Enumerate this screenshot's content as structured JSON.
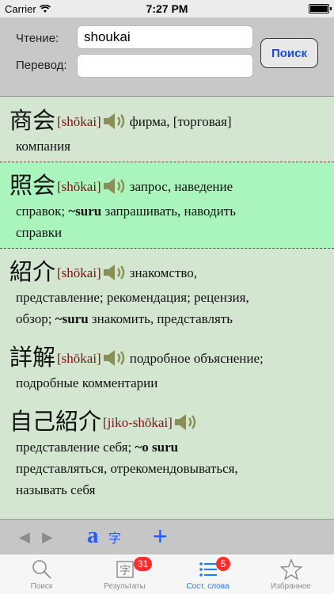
{
  "status_bar": {
    "carrier": "Carrier",
    "time": "7:27 PM"
  },
  "form": {
    "reading_label": "Чтение:",
    "reading_value": "shoukai",
    "translation_label": "Перевод:",
    "translation_value": "",
    "search_button": "Поиск"
  },
  "entries": [
    {
      "kanji": "商会",
      "reading": "[shōkai]",
      "def": "фирма, [торговая]",
      "line2": [
        {
          "text": "компания",
          "bold": false
        }
      ]
    },
    {
      "kanji": "照会",
      "reading": "[shōkai]",
      "def": "запрос, наведение",
      "line2": [
        {
          "text": "справок; ",
          "bold": false
        },
        {
          "text": "~suru",
          "bold": true
        },
        {
          "text": " запрашивать, наводить",
          "bold": false
        }
      ],
      "line3": [
        {
          "text": "справки",
          "bold": false
        }
      ]
    },
    {
      "kanji": "紹介",
      "reading": "[shōkai]",
      "def": "знакомство,",
      "line2": [
        {
          "text": "представление; рекомендация; рецензия,",
          "bold": false
        }
      ],
      "line3": [
        {
          "text": "обзор; ",
          "bold": false
        },
        {
          "text": "~suru",
          "bold": true
        },
        {
          "text": " знакомить, представлять",
          "bold": false
        }
      ]
    },
    {
      "kanji": "詳解",
      "reading": "[shōkai]",
      "def": "подробное объяснение;",
      "line2": [
        {
          "text": "подробные комментарии",
          "bold": false
        }
      ]
    },
    {
      "kanji": "自己紹介",
      "reading": "[jiko-shōkai]",
      "def": "",
      "line2": [
        {
          "text": "представление себя; ",
          "bold": false
        },
        {
          "text": "~o suru",
          "bold": true
        }
      ],
      "line3": [
        {
          "text": "представляться, отрекомендовываться,",
          "bold": false
        }
      ],
      "line4": [
        {
          "text": "называть себя",
          "bold": false
        }
      ]
    }
  ],
  "toolbar": {
    "latin_glyph": "a",
    "kana_glyph": "字",
    "plus": "+"
  },
  "tabs": [
    {
      "label": "Поиск",
      "icon": "search-icon"
    },
    {
      "label": "Результаты",
      "icon": "kanji-results-icon",
      "badge": "31"
    },
    {
      "label": "Сост. слова",
      "icon": "list-icon",
      "badge": "5"
    },
    {
      "label": "Избранное",
      "icon": "star-icon"
    }
  ],
  "colors": {
    "accent": "#1a7cff",
    "selected_row": "#a9f5bd",
    "list_bg": "#d2e6d0",
    "reading": "#7a1212",
    "badge": "#ff2d2d"
  }
}
